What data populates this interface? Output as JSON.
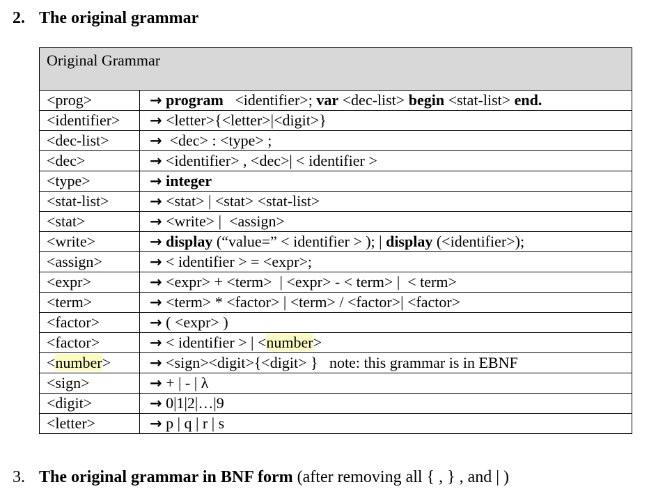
{
  "section2": {
    "number": "2.",
    "title": "The original grammar"
  },
  "table": {
    "header": "Original Grammar",
    "arrow": "→",
    "rows": [
      {
        "lhs": "<prog>",
        "rhs": [
          {
            "t": "program",
            "b": true
          },
          {
            "t": "   <identifier>; "
          },
          {
            "t": "var",
            "b": true
          },
          {
            "t": " <dec-list> "
          },
          {
            "t": "begin",
            "b": true
          },
          {
            "t": " <stat-list> "
          },
          {
            "t": "end.",
            "b": true
          }
        ]
      },
      {
        "lhs": "<identifier>",
        "rhs": [
          {
            "t": "<letter>{<letter>|<digit>}"
          }
        ]
      },
      {
        "lhs": "<dec-list>",
        "rhs": [
          {
            "t": " <dec> : <type> ;"
          }
        ]
      },
      {
        "lhs": "<dec>",
        "rhs": [
          {
            "t": "<identifier> , <dec>| < identifier >"
          }
        ]
      },
      {
        "lhs": "<type>",
        "rhs": [
          {
            "t": "integer",
            "b": true
          }
        ]
      },
      {
        "lhs": "<stat-list>",
        "rhs": [
          {
            "t": "<stat> | <stat> <stat-list>"
          }
        ]
      },
      {
        "lhs": "<stat>",
        "rhs": [
          {
            "t": "<write> |  <assign>"
          }
        ]
      },
      {
        "lhs": "<write>",
        "rhs": [
          {
            "t": "display",
            "b": true
          },
          {
            "t": " (“value=” < identifier > ); | "
          },
          {
            "t": "display",
            "b": true
          },
          {
            "t": " (<identifier>);"
          }
        ]
      },
      {
        "lhs": "<assign>",
        "rhs": [
          {
            "t": "< identifier > = <expr>;"
          }
        ]
      },
      {
        "lhs": "<expr>",
        "rhs": [
          {
            "t": "<expr> + <term>  | <expr> - < term> |  < term>"
          }
        ]
      },
      {
        "lhs": "<term>",
        "rhs": [
          {
            "t": "<term> * <factor> | <term> / <factor>| <factor>"
          }
        ]
      },
      {
        "lhs": "<factor>",
        "rhs": [
          {
            "t": "( <expr> )"
          }
        ]
      },
      {
        "lhs": "<factor>",
        "rhs": [
          {
            "t": "< identifier > | <"
          },
          {
            "t": "number",
            "h": true
          },
          {
            "t": ">"
          }
        ]
      },
      {
        "lhs": "<number>",
        "lhs_highlight": "number",
        "rhs": [
          {
            "t": "<sign><digit>{<digit> }   note: this grammar is in EBNF"
          }
        ]
      },
      {
        "lhs": "<sign>",
        "rhs": [
          {
            "t": "+ | - | λ"
          }
        ]
      },
      {
        "lhs": "<digit>",
        "rhs": [
          {
            "t": "0|1|2|…|9"
          }
        ]
      },
      {
        "lhs": "<letter>",
        "rhs": [
          {
            "t": "p | q | r | s"
          }
        ]
      }
    ]
  },
  "section3": {
    "number": "3.",
    "title_bold": "The original grammar in BNF form",
    "title_rest": " (after removing all { , } , and | )"
  },
  "colors": {
    "header_bg": "#d8d8d8",
    "highlight": "#fdfbc4"
  }
}
